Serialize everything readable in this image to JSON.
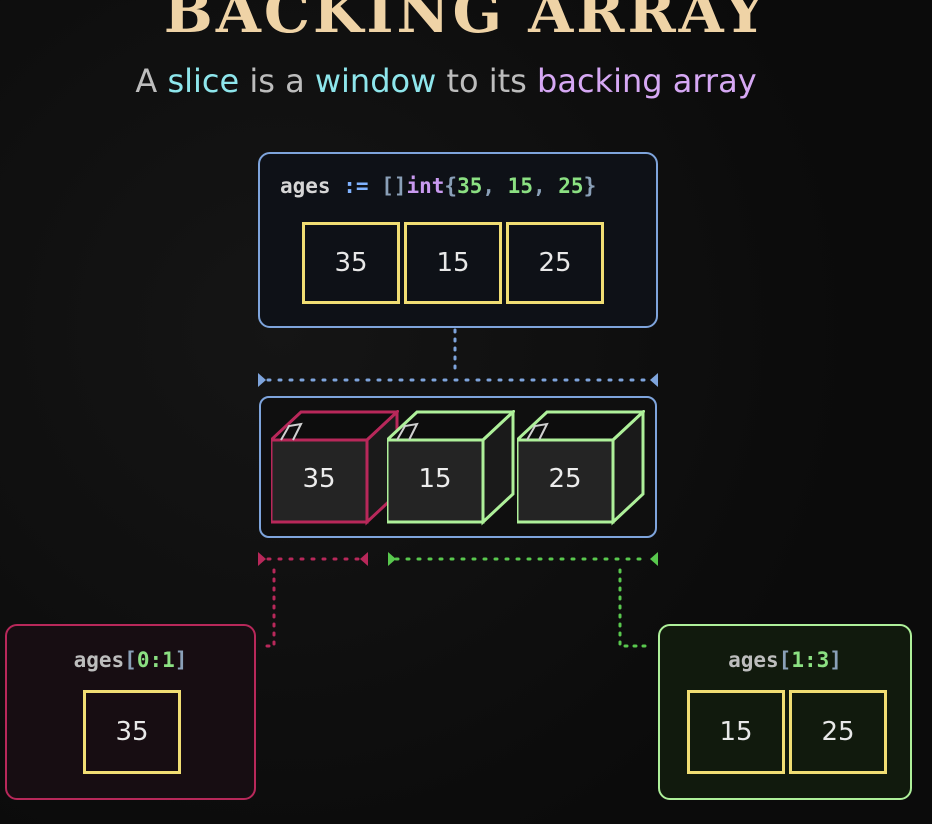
{
  "title": "BACKING ARRAY",
  "subtitle": {
    "part1": "A ",
    "word_slice": "slice",
    "part2": " is a ",
    "word_window": "window",
    "part3": " to its ",
    "word_backing": "backing array"
  },
  "declaration": {
    "name": "ages",
    "op": ":=",
    "brackets": "[]",
    "type": "int",
    "open": "{",
    "v1": "35",
    "v2": "15",
    "v3": "25",
    "sep": ", ",
    "close": "}",
    "cells": [
      "35",
      "15",
      "25"
    ]
  },
  "backing_array": {
    "cells": [
      "35",
      "15",
      "25"
    ]
  },
  "slice_left": {
    "name": "ages",
    "lbr": "[",
    "range": "0:1",
    "rbr": "]",
    "cells": [
      "35"
    ]
  },
  "slice_right": {
    "name": "ages",
    "lbr": "[",
    "range": "1:3",
    "rbr": "]",
    "cells": [
      "15",
      "25"
    ]
  },
  "colors": {
    "title": "#efd3a6",
    "blue_border": "#7ea4dc",
    "yellow_cell": "#f0dd73",
    "crimson": "#b8285a",
    "green": "#aef09a",
    "green_dots": "#59c84e"
  }
}
